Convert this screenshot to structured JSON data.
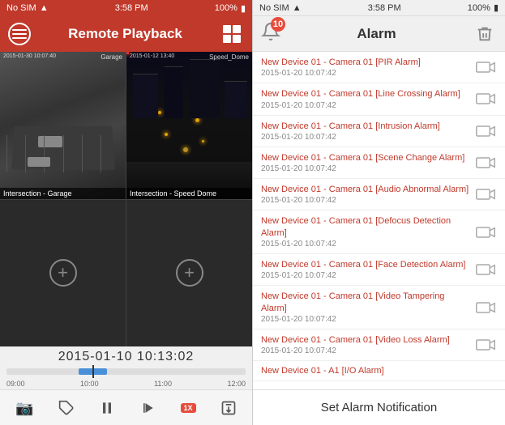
{
  "left": {
    "status_bar": {
      "carrier": "No SIM",
      "wifi": "WiFi",
      "time": "3:58 PM",
      "battery": "100%"
    },
    "title": "Remote Playback",
    "cameras": [
      {
        "id": "cam1",
        "label": "Intersection - Garage",
        "timestamp": "2015-01-30 10:07:40",
        "sublabel": "Garage",
        "has_feed": true
      },
      {
        "id": "cam2",
        "label": "Intersection - Speed Dome",
        "timestamp": "2015-01-12 13:40",
        "sublabel": "Speed_Dome",
        "has_feed": true
      },
      {
        "id": "cam3",
        "label": "",
        "has_feed": false
      },
      {
        "id": "cam4",
        "label": "",
        "has_feed": false
      }
    ],
    "timeline": {
      "current_time": "2015-01-10  10:13:02",
      "labels": [
        "09:00",
        "10:00",
        "11:00",
        "12:00"
      ]
    },
    "toolbar": {
      "screenshot": "📷",
      "tag": "🏷",
      "pause": "⏸",
      "skip": "⏭",
      "speed": "1X",
      "export": "📤"
    }
  },
  "right": {
    "status_bar": {
      "carrier": "No SIM",
      "wifi": "WiFi",
      "time": "3:58 PM",
      "battery": "100%"
    },
    "title": "Alarm",
    "badge_count": "10",
    "alarms": [
      {
        "id": 1,
        "title": "New Device 01 - Camera 01 [PIR Alarm]",
        "date": "2015-01-20 10:07:42"
      },
      {
        "id": 2,
        "title": "New Device 01 - Camera 01 [Line Crossing Alarm]",
        "date": "2015-01-20 10:07:42"
      },
      {
        "id": 3,
        "title": "New Device 01 - Camera 01 [Intrusion Alarm]",
        "date": "2015-01-20 10:07:42"
      },
      {
        "id": 4,
        "title": "New Device 01 - Camera 01 [Scene Change Alarm]",
        "date": "2015-01-20 10:07:42"
      },
      {
        "id": 5,
        "title": "New Device 01 - Camera 01 [Audio Abnormal Alarm]",
        "date": "2015-01-20 10:07:42"
      },
      {
        "id": 6,
        "title": "New Device 01 - Camera 01 [Defocus Detection Alarm]",
        "date": "2015-01-20 10:07:42"
      },
      {
        "id": 7,
        "title": "New Device 01 - Camera 01 [Face Detection Alarm]",
        "date": "2015-01-20 10:07:42"
      },
      {
        "id": 8,
        "title": "New Device 01 - Camera 01 [Video Tampering Alarm]",
        "date": "2015-01-20 10:07:42"
      },
      {
        "id": 9,
        "title": "New Device 01 - Camera 01 [Video Loss Alarm]",
        "date": "2015-01-20 10:07:42"
      },
      {
        "id": 10,
        "title": "New Device 01 - A1 [I/O Alarm]",
        "date": ""
      }
    ],
    "set_alarm_label": "Set Alarm Notification"
  }
}
